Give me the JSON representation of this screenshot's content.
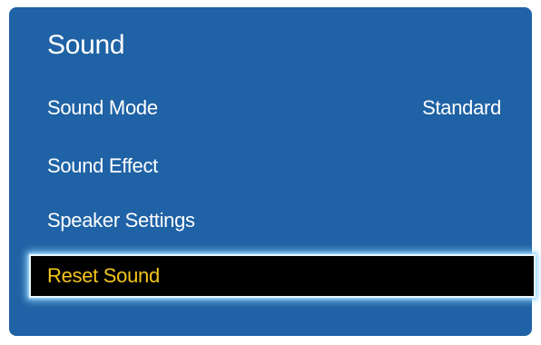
{
  "menu": {
    "title": "Sound",
    "items": [
      {
        "label": "Sound Mode",
        "value": "Standard"
      },
      {
        "label": "Sound Effect"
      },
      {
        "label": "Speaker Settings"
      },
      {
        "label": "Reset Sound"
      }
    ],
    "selected_index": 3
  },
  "colors": {
    "panel_background": "#1f62a5",
    "text": "#ffffff",
    "highlight_background": "#000000",
    "highlight_text": "#f3c51a",
    "highlight_glow": "#aee1ff"
  }
}
